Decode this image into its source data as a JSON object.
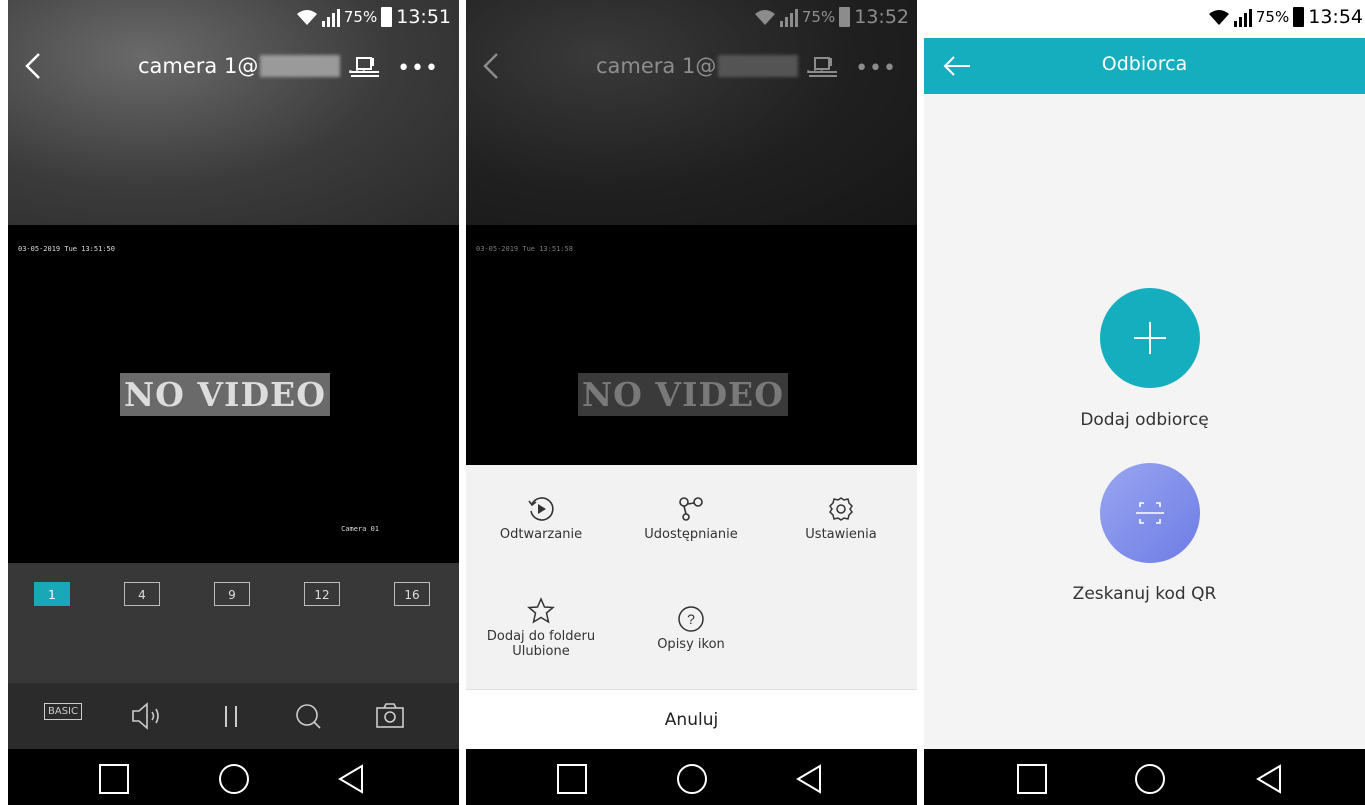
{
  "status": [
    {
      "battery": "75%",
      "time": "13:51"
    },
    {
      "battery": "75%",
      "time": "13:52"
    },
    {
      "battery": "75%",
      "time": "13:54"
    }
  ],
  "live": {
    "title": "camera 1@",
    "title_suffix": "...",
    "timestamp": "03-05-2019 Tue 13:51:50",
    "no_video": "NO VIDEO",
    "camera_label": "Camera 01",
    "grid_options": [
      "1",
      "4",
      "9",
      "12",
      "16"
    ],
    "active_grid": "1",
    "quality_label": "BASIC"
  },
  "menu": {
    "title": "camera 1@",
    "title_suffix": "...",
    "timestamp": "03-05-2019 Tue 13:51:58",
    "no_video": "NO VIDEO",
    "items": [
      {
        "label": "Odtwarzanie",
        "icon": "playback-icon"
      },
      {
        "label": "Udostępnianie",
        "icon": "share-icon"
      },
      {
        "label": "Ustawienia",
        "icon": "settings-icon"
      },
      {
        "label": "Dodaj do folderu Ulubione",
        "icon": "star-icon"
      },
      {
        "label": "Opisy ikon",
        "icon": "help-icon"
      }
    ],
    "cancel": "Anuluj"
  },
  "recipient": {
    "title": "Odbiorca",
    "add_label": "Dodaj odbiorcę",
    "scan_label": "Zeskanuj kod QR",
    "accent": "#14aebf"
  }
}
